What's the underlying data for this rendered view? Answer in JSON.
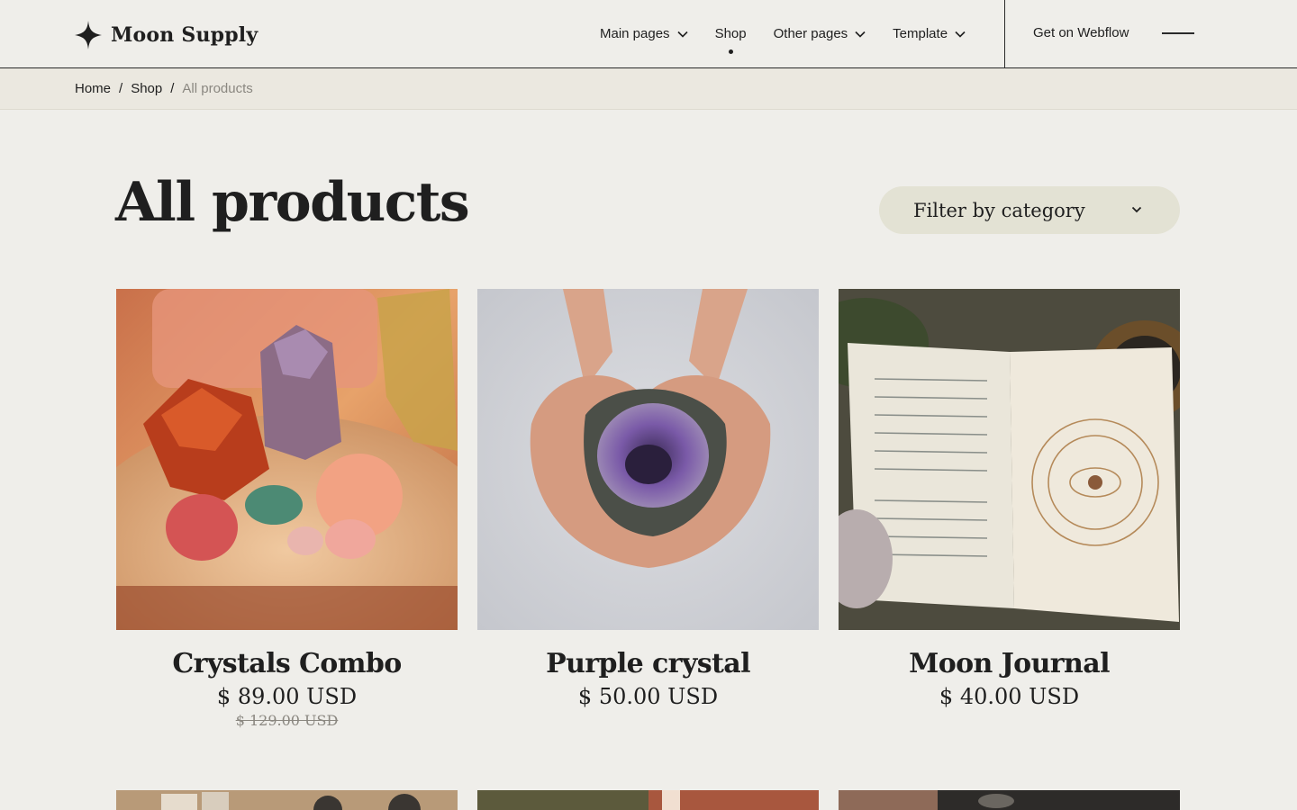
{
  "header": {
    "brand": "Moon Supply",
    "nav": [
      {
        "label": "Main pages",
        "dropdown": true,
        "active": false
      },
      {
        "label": "Shop",
        "dropdown": false,
        "active": true
      },
      {
        "label": "Other pages",
        "dropdown": true,
        "active": false
      },
      {
        "label": "Template",
        "dropdown": true,
        "active": false
      }
    ],
    "cta_label": "Get on Webflow",
    "menu_icon": "menu-line-icon"
  },
  "breadcrumb": {
    "home": "Home",
    "shop": "Shop",
    "current": "All products",
    "separator": "/"
  },
  "page": {
    "title": "All products",
    "filter_label": "Filter by category"
  },
  "products": [
    {
      "name": "Crystals Combo",
      "price": "$ 89.00 USD",
      "compare_price": "$ 129.00 USD"
    },
    {
      "name": "Purple crystal",
      "price": "$ 50.00 USD"
    },
    {
      "name": "Moon Journal",
      "price": "$ 40.00 USD"
    }
  ],
  "colors": {
    "background": "#efeeea",
    "breadcrumb_bg": "#ebe8e0",
    "filter_bg": "#e3e2d4",
    "text": "#1f1f1f",
    "muted": "#8a8780"
  }
}
